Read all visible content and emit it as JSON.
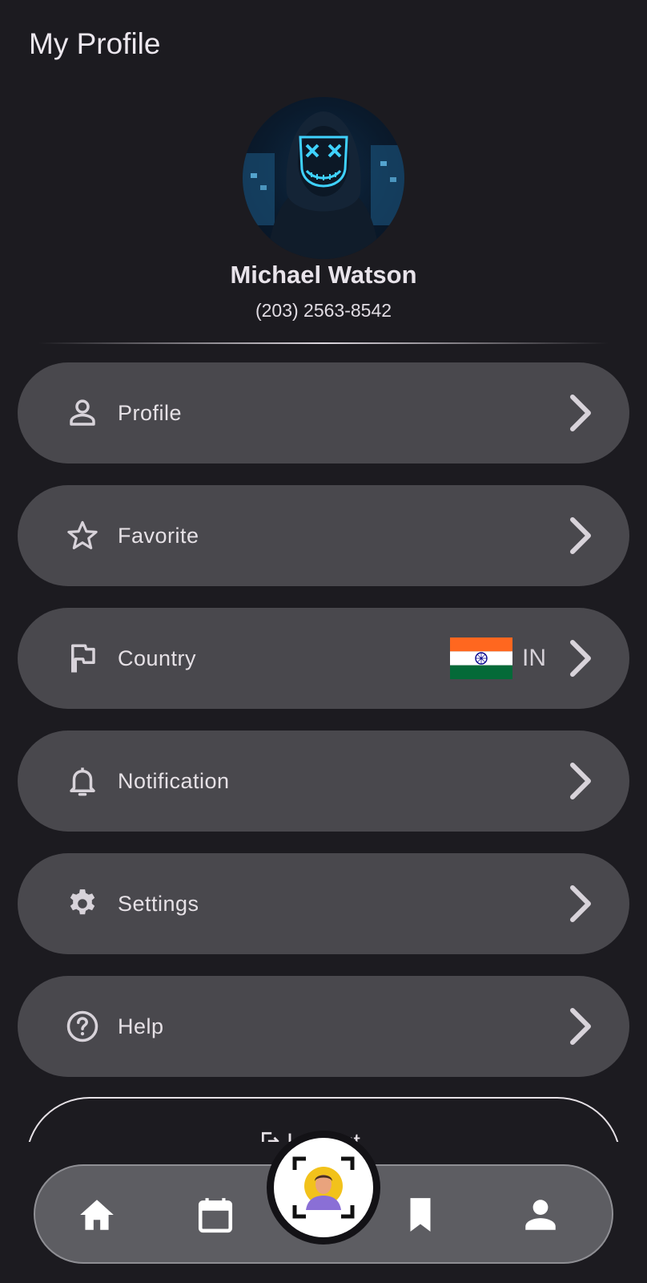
{
  "header": {
    "title": "My Profile"
  },
  "profile": {
    "name": "Michael Watson",
    "phone": "(203) 2563-8542"
  },
  "menu": [
    {
      "label": "Profile",
      "icon": "person-outline-icon"
    },
    {
      "label": "Favorite",
      "icon": "star-outline-icon"
    },
    {
      "label": "Country",
      "icon": "flag-outline-icon",
      "value": "IN",
      "flag": "india-flag"
    },
    {
      "label": "Notification",
      "icon": "bell-outline-icon"
    },
    {
      "label": "Settings",
      "icon": "gear-icon"
    },
    {
      "label": "Help",
      "icon": "help-circle-icon"
    }
  ],
  "logout": {
    "label": "Logout"
  },
  "bottom_nav": [
    {
      "icon": "home-icon"
    },
    {
      "icon": "calendar-icon"
    },
    {
      "icon": "face-scan-icon"
    },
    {
      "icon": "bookmark-icon"
    },
    {
      "icon": "person-icon"
    }
  ],
  "colors": {
    "background": "#1c1b20",
    "card": "#49484d",
    "nav_bar": "#5d5d62",
    "text": "#e6e1e6",
    "flag_saffron": "#ff671f",
    "flag_green": "#046a38",
    "flag_chakra": "#06038d"
  }
}
